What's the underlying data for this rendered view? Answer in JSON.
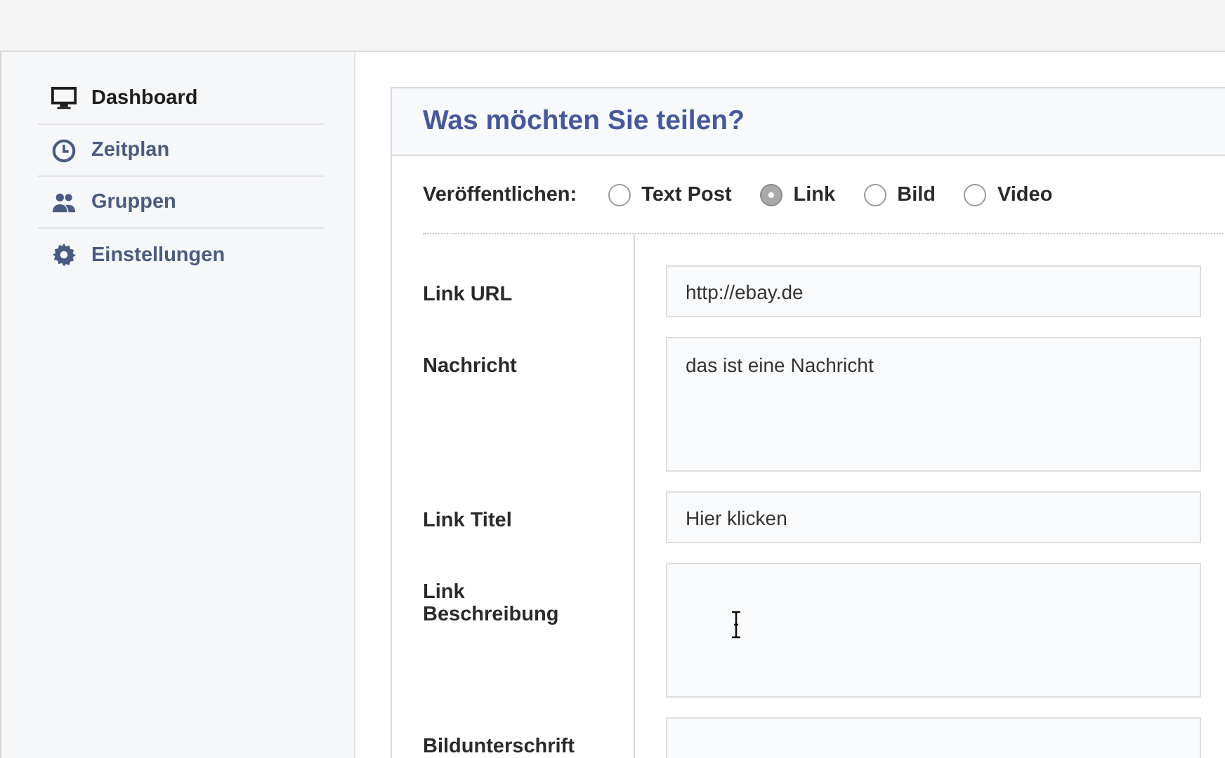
{
  "sidebar": {
    "items": [
      {
        "label": "Dashboard",
        "kind": "monitor",
        "selected": true
      },
      {
        "label": "Zeitplan",
        "kind": "clock",
        "selected": false
      },
      {
        "label": "Gruppen",
        "kind": "people",
        "selected": false
      },
      {
        "label": "Einstellungen",
        "kind": "gear",
        "selected": false
      }
    ]
  },
  "card": {
    "title": "Was möchten Sie teilen?",
    "publish": {
      "label": "Veröffentlichen:",
      "options": [
        {
          "label": "Text Post",
          "selected": false
        },
        {
          "label": "Link",
          "selected": true
        },
        {
          "label": "Bild",
          "selected": false
        },
        {
          "label": "Video",
          "selected": false
        }
      ]
    },
    "fields": [
      {
        "label": "Link URL",
        "kind": "line",
        "value": "http://ebay.de"
      },
      {
        "label": "Nachricht",
        "kind": "area",
        "value": "das ist eine Nachricht"
      },
      {
        "label": "Link Titel",
        "kind": "line",
        "value": "Hier klicken"
      },
      {
        "label": "Link\nBeschreibung",
        "kind": "area",
        "cursor": true
      },
      {
        "label": "Bildunterschrift",
        "kind": "line"
      }
    ]
  }
}
